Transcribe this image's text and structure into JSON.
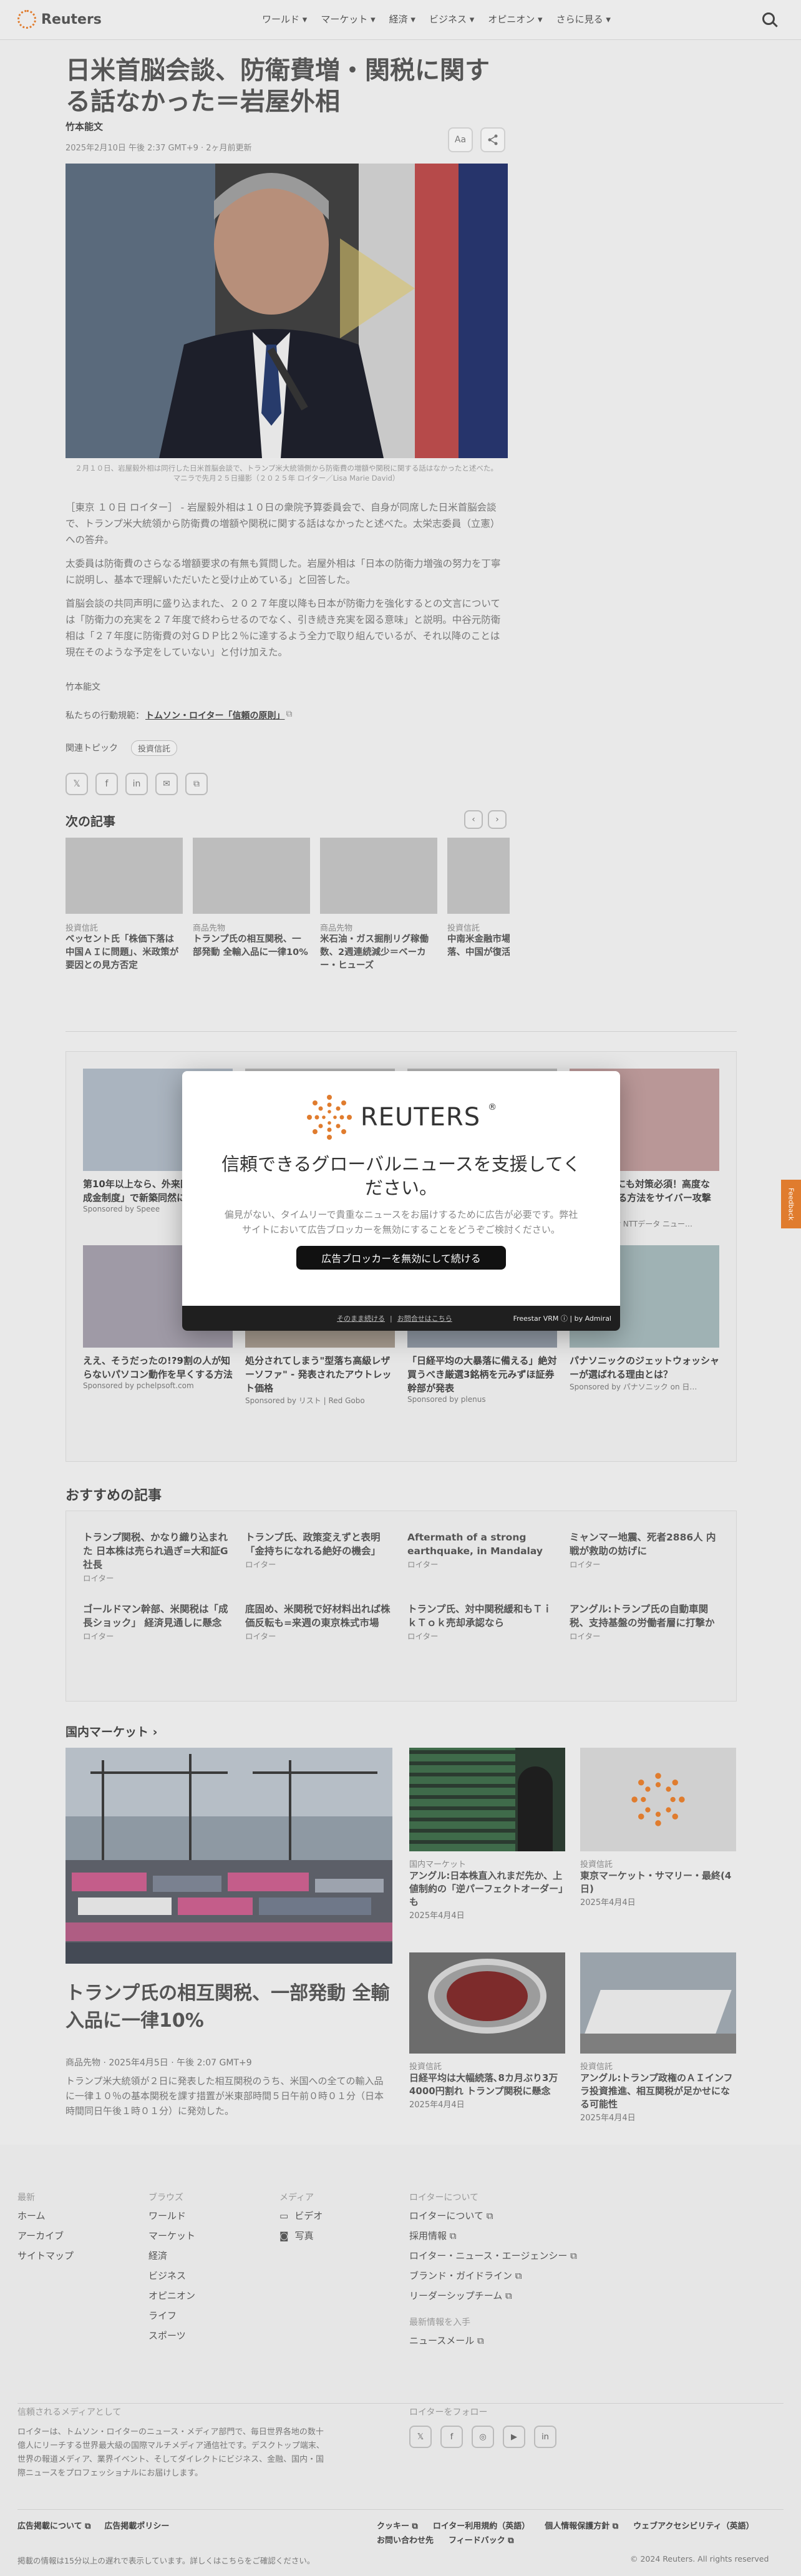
{
  "header": {
    "logo_text": "Reuters",
    "nav": [
      "ワールド ▾",
      "マーケット ▾",
      "経済 ▾",
      "ビジネス ▾",
      "オピニオン ▾",
      "さらに見る ▾"
    ],
    "search_icon": "search-icon"
  },
  "article": {
    "title": "日米首脳会談、防衛費増・関税に関する話なかった＝岩屋外相",
    "author": "竹本能文",
    "date": "2025年2月10日 午後 2:37 GMT+9 · 2ヶ月前更新",
    "tools": {
      "text_size": "Aa",
      "share": "share-icon"
    },
    "caption": "２月１０日、岩屋毅外相は同行した日米首脳会談で、トランプ米大統領側から防衛費の増額や関税に関する話はなかったと述べた。マニラで先月２５日撮影（２０２５年 ロイター／Lisa Marie David）",
    "paragraphs": [
      "［東京 １０日 ロイター］ - 岩屋毅外相は１０日の衆院予算委員会で、自身が同席した日米首脳会談で、トランプ米大統領から防衛費の増額や関税に関する話はなかったと述べた。太栄志委員（立憲）への答弁。",
      "太委員は防衛費のさらなる増額要求の有無も質問した。岩屋外相は「日本の防衛力増強の努力を丁寧に説明し、基本で理解いただいたと受け止めている」と回答した。",
      "首脳会談の共同声明に盛り込まれた、２０２７年度以降も日本が防衛力を強化するとの文言については「防衛力の充実を２７年度で終わらせるのでなく、引き続き充実を図る意味」と説明。中谷元防衛相は「２７年度に防衛費の対ＧＤＰ比２％に達するよう全力で取り組んでいるが、それ以降のことは現在そのような予定をしていない」と付け加えた。"
    ],
    "byline": "竹本能文",
    "principles_prefix": "私たちの行動規範：",
    "principles_link": "トムソン・ロイター「信頼の原則」",
    "topics_label": "関連トピック",
    "topic": "投資信託",
    "share": [
      "𝕏",
      "f",
      "in",
      "✉",
      "⧉"
    ]
  },
  "next": {
    "title": "次の記事",
    "items": [
      {
        "cat": "投資信託",
        "text": "ベッセント氏「株価下落は中国ＡＩに問題」、米政策が要因との見方否定"
      },
      {
        "cat": "商品先物",
        "text": "トランプ氏の相互関税、一部発動 全輸入品に一律10%"
      },
      {
        "cat": "商品先物",
        "text": "米石油・ガス掘削リグ稼働数、2週連続減少＝ベーカー・ヒューズ"
      },
      {
        "cat": "投資信託",
        "text": "中南米金融市場、株式下落、中国が復活し復措置"
      }
    ]
  },
  "ads": {
    "items": [
      {
        "t": "第10年以上なら、外来医療の「助成金制度」で新築同然に",
        "s": "Sponsored by Speee"
      },
      {
        "t": "",
        "s": ""
      },
      {
        "t": "",
        "s": ""
      },
      {
        "t": "マーケットにも対策必須！高度なAIを活用する方法をサイバー攻撃の脅威",
        "s": "Sponsored by NTTデータ ニュー…"
      },
      {
        "t": "ええ、そうだったの!?9割の人が知らないパソコン動作を早くする方法",
        "s": "Sponsored by pchelpsoft.com"
      },
      {
        "t": "処分されてしまう\"型落ち高級レザーソファ\" - 発表されたアウトレット価格",
        "s": "Sponsored by リスト | Red Gobo"
      },
      {
        "t": "「日経平均の大暴落に備える」絶対買うべき厳選3銘柄を元みずほ証券幹部が発表",
        "s": "Sponsored by plenus"
      },
      {
        "t": "パナソニックのジェットウォッシャーが選ばれる理由とは？",
        "s": "Sponsored by パナソニック on 日…"
      }
    ]
  },
  "modal": {
    "brand": "REUTERS",
    "heading": "信頼できるグローバルニュースを支援してください。",
    "body": "偏見がない、タイムリーで貴重なニュースをお届けするために広告が必要です。弊社サイトにおいて広告ブロッカーを無効にすることをどうぞご検討ください。",
    "button": "広告ブロッカーを無効にして続ける",
    "link1": "そのまま続ける",
    "link2": "お問合せはこちら",
    "powered": "Freestar VRM ⓘ | by Admiral"
  },
  "recommended": {
    "title": "おすすめの記事",
    "items": [
      {
        "t": "トランプ関税、かなり織り込まれた 日本株は売られ過ぎ=大和証G社長",
        "s": "ロイター"
      },
      {
        "t": "トランプ氏、政策変えずと表明 「金持ちになれる絶好の機会」",
        "s": "ロイター"
      },
      {
        "t": "Aftermath of a strong earthquake, in Mandalay",
        "s": "ロイター"
      },
      {
        "t": "ミャンマー地震、死者2886人 内戦が救助の妨げに",
        "s": "ロイター"
      },
      {
        "t": "ゴールドマン幹部、米関税は「成長ショック」 経済見通しに懸念",
        "s": "ロイター"
      },
      {
        "t": "底固め、米関税で好材料出れば株価反転も=来週の東京株式市場",
        "s": "ロイター"
      },
      {
        "t": "トランプ氏、対中関税緩和もＴｉｋＴｏｋ売却承認なら",
        "s": "ロイター"
      },
      {
        "t": "アングル:トランプ氏の自動車関税、支持基盤の労働者層に打撃か",
        "s": "ロイター"
      }
    ]
  },
  "markets": {
    "title": "国内マーケット ›",
    "main": {
      "t": "トランプ氏の相互関税、一部発動 全輸入品に一律10%",
      "meta": "商品先物 · 2025年4月5日 · 午後 2:07 GMT+9",
      "desc": "トランプ米大統領が２日に発表した相互関税のうち、米国への全ての輸入品に一律１０％の基本関税を課す措置が米東部時間５日午前０時０１分（日本時間同日午後１時０１分）に発効した。"
    },
    "items": [
      {
        "cat": "国内マーケット",
        "t": "アングル:日本株直入れまだ先か、上値制約の「逆パーフェクトオーダー」も",
        "d": "2025年4月4日"
      },
      {
        "cat": "投資信託",
        "t": "東京マーケット・サマリー・最終(4日)",
        "d": "2025年4月4日"
      },
      {
        "cat": "投資信託",
        "t": "日経平均は大幅続落､8カ月ぶり3万4000円割れ トランプ関税に懸念",
        "d": "2025年4月4日"
      },
      {
        "cat": "投資信託",
        "t": "アングル:トランプ政権のＡＩインフラ投資推進、相互関税が足かせになる可能性",
        "d": "2025年4月4日"
      }
    ]
  },
  "footer": {
    "col1": {
      "h": "最新",
      "links": [
        "ホーム",
        "アーカイブ",
        "サイトマップ"
      ]
    },
    "col2": {
      "h": "ブラウズ",
      "links": [
        "ワールド",
        "マーケット",
        "経済",
        "ビジネス",
        "オピニオン",
        "ライフ",
        "スポーツ"
      ]
    },
    "col3": {
      "h": "メディア",
      "links": [
        "ビデオ",
        "写真"
      ]
    },
    "col4": {
      "h": "ロイターについて",
      "links": [
        "ロイターについて ⧉",
        "採用情報 ⧉",
        "ロイター・ニュース・エージェンシー ⧉",
        "ブランド・ガイドライン ⧉",
        "リーダーシップチーム ⧉"
      ]
    },
    "news": {
      "h": "最新情報を入手",
      "link": "ニュースメール ⧉"
    },
    "trust": {
      "h": "信頼されるメディアとして",
      "body": "ロイターは、トムソン・ロイターのニュース・メディア部門で、毎日世界各地の数十億人にリーチする世界最大級の国際マルチメディア通信社です。デスクトップ端末、世界の報道メディア、業界イベント、そしてダイレクトにビジネス、金融、国内・国際ニュースをプロフェッショナルにお届けします。"
    },
    "follow": {
      "h": "ロイターをフォロー",
      "icons": [
        "𝕏",
        "f",
        "◎",
        "▶",
        "in"
      ]
    },
    "bottom_left": [
      "広告掲載について ⧉",
      "広告掲載ポリシー"
    ],
    "bottom_right": [
      "クッキー ⧉",
      "ロイター利用規約（英語）",
      "個人情報保護方針 ⧉",
      "ウェブアクセシビリティ（英語）",
      "お問い合わせ先",
      "フィードバック ⧉"
    ],
    "notice": "掲載の情報は15分以上の遅れで表示しています。詳しくはこちらをご確認ください。",
    "copyright": "© 2024 Reuters. All rights reserved"
  },
  "feedback": "Feedback",
  "colors": {
    "accent": "#e07c2e",
    "button": "#111111"
  }
}
